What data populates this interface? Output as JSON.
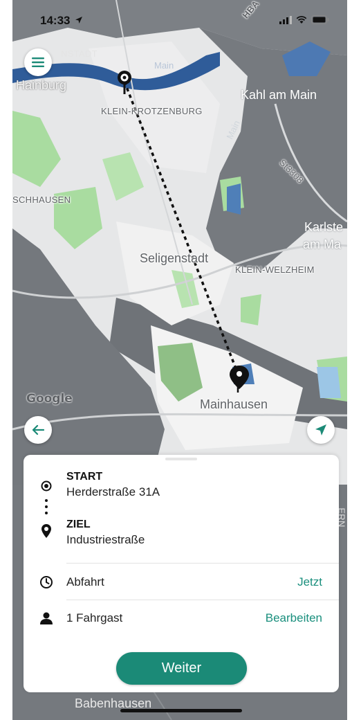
{
  "status_bar": {
    "time": "14:33"
  },
  "map": {
    "labels": {
      "nstadt": "NSTADT",
      "hainburg": "Hainburg",
      "main_river_top": "Main",
      "kahl_am_main": "Kahl am Main",
      "klein_krotzenburg": "KLEIN-KROTZENBURG",
      "main_river_mid": "Main",
      "st3308": "St3308",
      "schhausen": "SCHHAUSEN",
      "karlste": "Karlste",
      "am_ma": "am Ma",
      "seligenstadt": "Seligenstadt",
      "klein_welzheim": "KLEIN-WELZHEIM",
      "mainhausen": "Mainhausen",
      "babenhausen": "Babenhausen",
      "road_top_right": "HBA",
      "road_right_edge": "ERN"
    },
    "attribution": "Google"
  },
  "route": {
    "start_title": "START",
    "start_address": "Herderstraße 31A",
    "end_title": "ZIEL",
    "end_address": "Industriestraße"
  },
  "options": {
    "departure_label": "Abfahrt",
    "departure_value": "Jetzt",
    "passengers_label": "1 Fahrgast",
    "passengers_action": "Bearbeiten"
  },
  "cta": {
    "label": "Weiter"
  },
  "colors": {
    "accent": "#1b8a77",
    "accent_text": "#1a8f7d"
  },
  "icons": {
    "menu": "menu-icon",
    "back": "arrow-left-icon",
    "locate": "navigation-arrow-icon",
    "start": "target-icon",
    "end": "location-pin-icon",
    "clock": "clock-icon",
    "person": "person-icon"
  }
}
